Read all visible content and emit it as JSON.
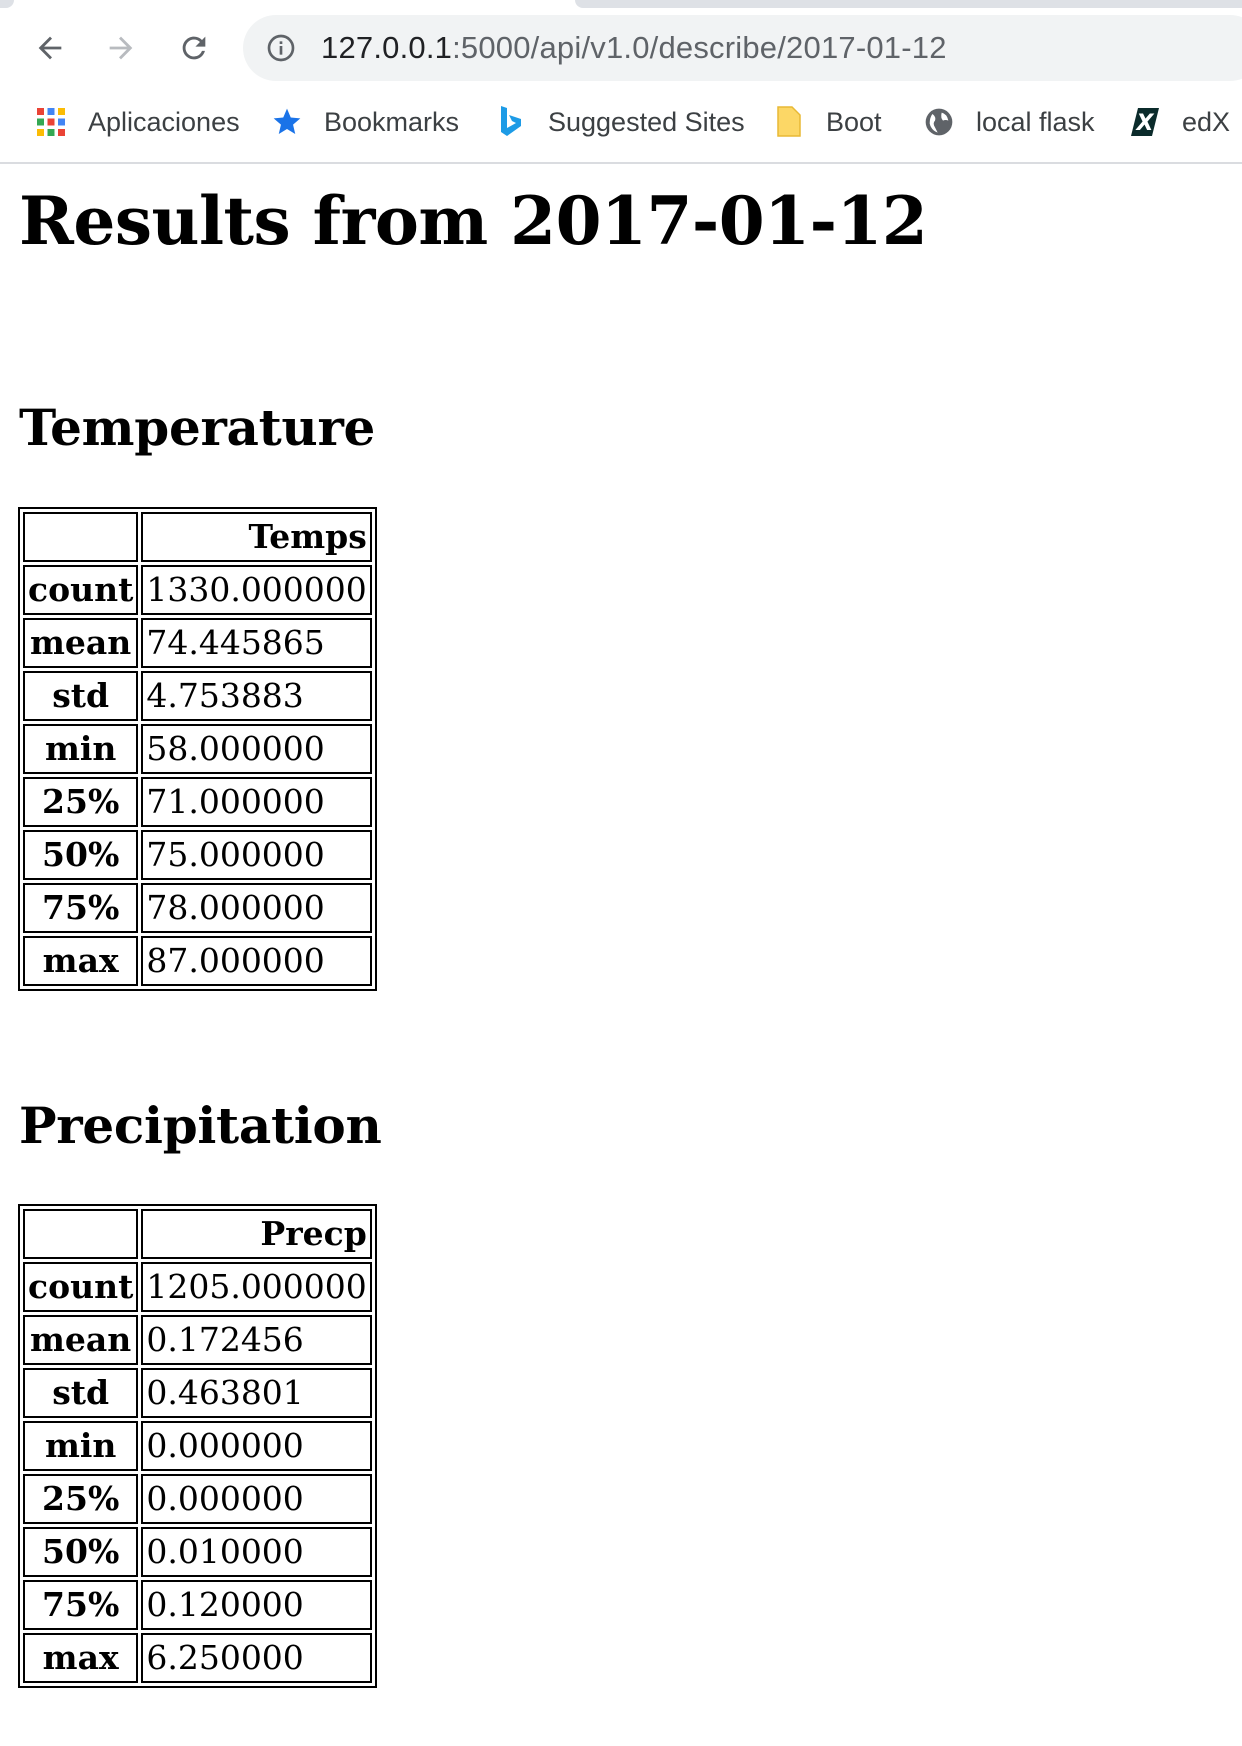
{
  "browser": {
    "url_host": "127.0.0.1",
    "url_path": ":5000/api/v1.0/describe/2017-01-12",
    "bookmarks": [
      {
        "label": "Aplicaciones",
        "icon": "apps-grid-icon"
      },
      {
        "label": "Bookmarks",
        "icon": "star-icon"
      },
      {
        "label": "Suggested Sites",
        "icon": "bing-icon"
      },
      {
        "label": "Boot",
        "icon": "folder-icon"
      },
      {
        "label": "local flask",
        "icon": "globe-icon"
      },
      {
        "label": "edX",
        "icon": "edx-icon"
      }
    ]
  },
  "page": {
    "title": "Results from 2017-01-12",
    "temperature": {
      "heading": "Temperature",
      "column": "Temps",
      "rows": [
        {
          "stat": "count",
          "value": "1330.000000"
        },
        {
          "stat": "mean",
          "value": "74.445865"
        },
        {
          "stat": "std",
          "value": "4.753883"
        },
        {
          "stat": "min",
          "value": "58.000000"
        },
        {
          "stat": "25%",
          "value": "71.000000"
        },
        {
          "stat": "50%",
          "value": "75.000000"
        },
        {
          "stat": "75%",
          "value": "78.000000"
        },
        {
          "stat": "max",
          "value": "87.000000"
        }
      ]
    },
    "precipitation": {
      "heading": "Precipitation",
      "column": "Precp",
      "rows": [
        {
          "stat": "count",
          "value": "1205.000000"
        },
        {
          "stat": "mean",
          "value": "0.172456"
        },
        {
          "stat": "std",
          "value": "0.463801"
        },
        {
          "stat": "min",
          "value": "0.000000"
        },
        {
          "stat": "25%",
          "value": "0.000000"
        },
        {
          "stat": "50%",
          "value": "0.010000"
        },
        {
          "stat": "75%",
          "value": "0.120000"
        },
        {
          "stat": "max",
          "value": "6.250000"
        }
      ]
    }
  }
}
